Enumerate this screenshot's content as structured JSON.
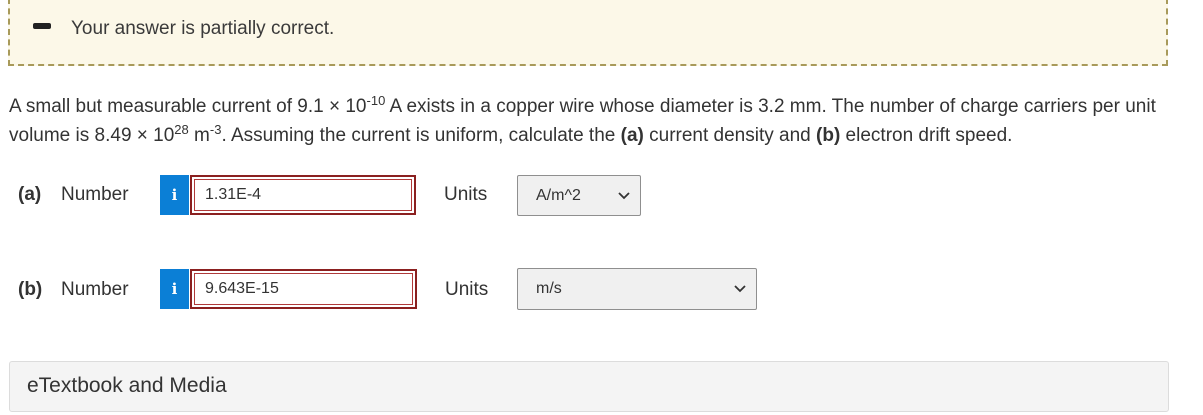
{
  "feedback": {
    "message": "Your answer is partially correct."
  },
  "question": {
    "p1": "A small but measurable current of 9.1 × 10",
    "exp1": "-10",
    "p2": " A exists in a copper wire whose diameter is 3.2 mm. The number of charge carriers per unit volume is 8.49 × 10",
    "exp2": "28",
    "p3": " m",
    "exp3": "-3",
    "p4": ". Assuming the current is uniform, calculate the ",
    "bold_a": "(a)",
    "p5": " current density and ",
    "bold_b": "(b)",
    "p6": " electron drift speed."
  },
  "parts": [
    {
      "label": "(a)",
      "number_label": "Number",
      "info": "i",
      "value": "1.31E-4",
      "units_label": "Units",
      "unit": "A/m^2"
    },
    {
      "label": "(b)",
      "number_label": "Number",
      "info": "i",
      "value": "9.643E-15",
      "units_label": "Units",
      "unit": "m/s"
    }
  ],
  "etextbook": {
    "label": "eTextbook and Media"
  },
  "icons": {
    "status": "minus-icon",
    "info": "info-icon",
    "dropdown": "chevron-down-icon"
  },
  "colors": {
    "feedback_bg": "#fcf8e8",
    "info_button": "#0b7fd6",
    "answer_border": "#8b2020"
  }
}
